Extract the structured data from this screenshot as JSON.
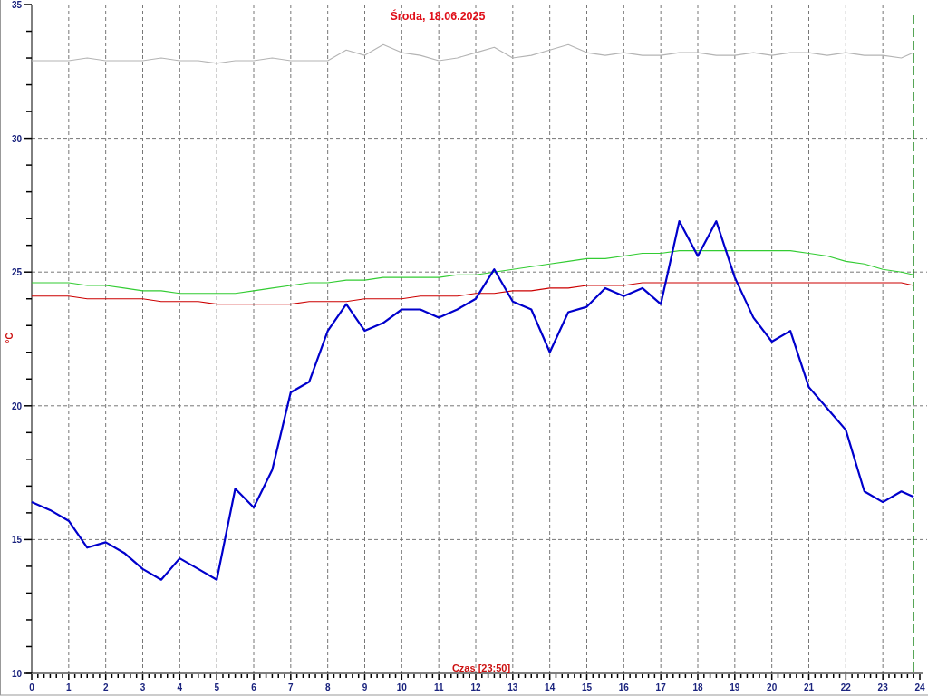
{
  "chart_data": {
    "type": "line",
    "title": "Środa, 18.06.2025",
    "xlabel": "Czas [23:50]",
    "ylabel": "°C",
    "xlim": [
      0,
      24
    ],
    "ylim": [
      10,
      35
    ],
    "xticks": [
      0,
      1,
      2,
      3,
      4,
      5,
      6,
      7,
      8,
      9,
      10,
      11,
      12,
      13,
      14,
      15,
      16,
      17,
      18,
      19,
      20,
      21,
      22,
      23,
      24
    ],
    "yticks": [
      10,
      15,
      20,
      25,
      30,
      35
    ],
    "x": [
      0,
      0.5,
      1,
      1.5,
      2,
      2.5,
      3,
      3.5,
      4,
      4.5,
      5,
      5.5,
      6,
      6.5,
      7,
      7.5,
      8,
      8.5,
      9,
      9.5,
      10,
      10.5,
      11,
      11.5,
      12,
      12.5,
      13,
      13.5,
      14,
      14.5,
      15,
      15.5,
      16,
      16.5,
      17,
      17.5,
      18,
      18.5,
      19,
      19.5,
      20,
      20.5,
      21,
      21.5,
      22,
      22.5,
      23,
      23.5,
      23.83
    ],
    "series": [
      {
        "color": "#b4b4b4",
        "values": [
          32.9,
          32.9,
          32.9,
          33.0,
          32.9,
          32.9,
          32.9,
          33.0,
          32.9,
          32.9,
          32.8,
          32.9,
          32.9,
          33.0,
          32.9,
          32.9,
          32.9,
          33.3,
          33.1,
          33.5,
          33.2,
          33.1,
          32.9,
          33.0,
          33.2,
          33.4,
          33.0,
          33.1,
          33.3,
          33.5,
          33.2,
          33.1,
          33.2,
          33.1,
          33.1,
          33.2,
          33.2,
          33.1,
          33.1,
          33.2,
          33.1,
          33.2,
          33.2,
          33.1,
          33.2,
          33.1,
          33.1,
          33.0,
          33.2
        ]
      },
      {
        "color": "#33cc33",
        "values": [
          24.6,
          24.6,
          24.6,
          24.5,
          24.5,
          24.4,
          24.3,
          24.3,
          24.2,
          24.2,
          24.2,
          24.2,
          24.3,
          24.4,
          24.5,
          24.6,
          24.6,
          24.7,
          24.7,
          24.8,
          24.8,
          24.8,
          24.8,
          24.9,
          24.9,
          25.0,
          25.1,
          25.2,
          25.3,
          25.4,
          25.5,
          25.5,
          25.6,
          25.7,
          25.7,
          25.8,
          25.8,
          25.8,
          25.8,
          25.8,
          25.8,
          25.8,
          25.7,
          25.6,
          25.4,
          25.3,
          25.1,
          25.0,
          24.9
        ]
      },
      {
        "color": "#cc0000",
        "values": [
          24.1,
          24.1,
          24.1,
          24.0,
          24.0,
          24.0,
          24.0,
          23.9,
          23.9,
          23.9,
          23.8,
          23.8,
          23.8,
          23.8,
          23.8,
          23.9,
          23.9,
          23.9,
          24.0,
          24.0,
          24.0,
          24.1,
          24.1,
          24.1,
          24.2,
          24.2,
          24.3,
          24.3,
          24.4,
          24.4,
          24.5,
          24.5,
          24.5,
          24.6,
          24.6,
          24.6,
          24.6,
          24.6,
          24.6,
          24.6,
          24.6,
          24.6,
          24.6,
          24.6,
          24.6,
          24.6,
          24.6,
          24.6,
          24.5
        ]
      },
      {
        "color": "#0000cc",
        "values": [
          16.4,
          16.1,
          15.7,
          14.7,
          14.9,
          14.5,
          13.9,
          13.5,
          14.3,
          13.9,
          13.5,
          16.9,
          16.2,
          17.6,
          20.5,
          20.9,
          22.8,
          23.8,
          22.8,
          23.1,
          23.6,
          23.6,
          23.3,
          23.6,
          24.0,
          25.1,
          23.9,
          23.6,
          22.0,
          23.5,
          23.7,
          24.4,
          24.1,
          24.4,
          23.8,
          26.9,
          25.6,
          26.9,
          24.8,
          23.3,
          22.4,
          22.8,
          20.7,
          19.9,
          19.1,
          16.8,
          16.4,
          16.8,
          16.6
        ]
      }
    ],
    "grid": true,
    "ref_lines": [
      {
        "axis": "x",
        "value": 23.83,
        "color": "#007700"
      }
    ]
  }
}
